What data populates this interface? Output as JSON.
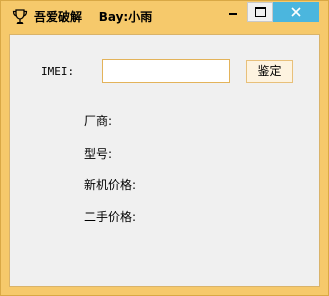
{
  "window": {
    "title": "吾爱破解    Bay:小雨",
    "icon": "trophy-icon"
  },
  "form": {
    "imei_label": "IMEI:",
    "imei_value": "",
    "check_button_label": "鉴定"
  },
  "info": {
    "manufacturer_label": "厂商:",
    "model_label": "型号:",
    "new_price_label": "新机价格:",
    "used_price_label": "二手价格:"
  },
  "colors": {
    "titlebar": "#f6c96b",
    "close_button": "#4bb6de",
    "client_background": "#f0f0f0",
    "input_border": "#e3b35a"
  }
}
